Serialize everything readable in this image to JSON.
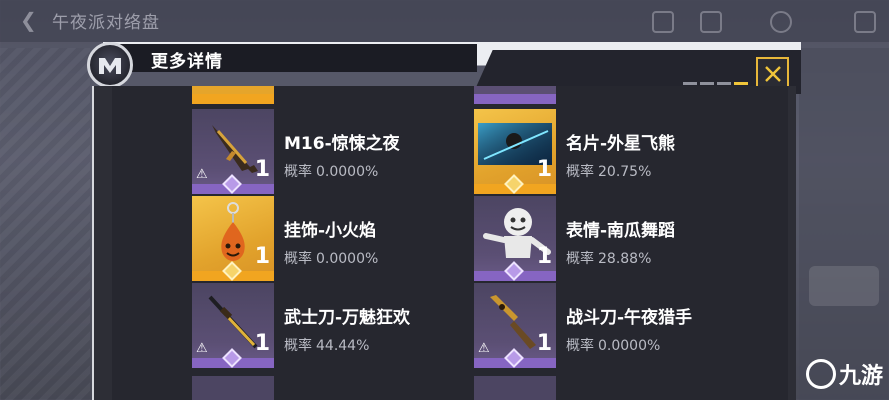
{
  "background": {
    "title": "午夜派对络盘"
  },
  "dialog": {
    "title": "更多详情",
    "page_indicator_active": 4,
    "page_indicator_total": 4
  },
  "items": [
    {
      "name": "M16-惊悚之夜",
      "prob_label": "概率",
      "prob": "0.0000%",
      "qty": "1",
      "rarity": "purple",
      "icon": "rifle-icon"
    },
    {
      "name": "名片-外星飞熊",
      "prob_label": "概率",
      "prob": "20.75%",
      "qty": "1",
      "rarity": "gold",
      "icon": "namecard-icon"
    },
    {
      "name": "挂饰-小火焰",
      "prob_label": "概率",
      "prob": "0.0000%",
      "qty": "1",
      "rarity": "gold",
      "icon": "pendant-icon"
    },
    {
      "name": "表情-南瓜舞蹈",
      "prob_label": "概率",
      "prob": "28.88%",
      "qty": "1",
      "rarity": "purple",
      "icon": "emote-icon"
    },
    {
      "name": "武士刀-万魅狂欢",
      "prob_label": "概率",
      "prob": "44.44%",
      "qty": "1",
      "rarity": "purple",
      "icon": "katana-icon"
    },
    {
      "name": "战斗刀-午夜猎手",
      "prob_label": "概率",
      "prob": "0.0000%",
      "qty": "1",
      "rarity": "purple",
      "icon": "combat-knife-icon"
    }
  ],
  "watermark": {
    "text": "九游"
  },
  "colors": {
    "gold_accent": "#f1a520",
    "purple_accent": "#8665c2",
    "close_border": "#e7b73a"
  }
}
